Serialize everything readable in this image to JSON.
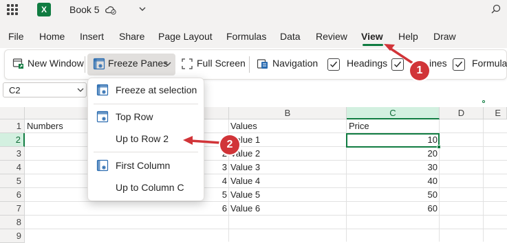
{
  "app": {
    "logo_letter": "X",
    "title": "Book 5"
  },
  "menu": {
    "tabs": [
      {
        "label": "File"
      },
      {
        "label": "Home"
      },
      {
        "label": "Insert"
      },
      {
        "label": "Share"
      },
      {
        "label": "Page Layout"
      },
      {
        "label": "Formulas"
      },
      {
        "label": "Data"
      },
      {
        "label": "Review"
      },
      {
        "label": "View"
      },
      {
        "label": "Help"
      },
      {
        "label": "Draw"
      }
    ],
    "active": "View"
  },
  "ribbon": {
    "new_window": "New Window",
    "freeze_panes": "Freeze Panes",
    "full_screen": "Full Screen",
    "navigation": "Navigation",
    "headings": "Headings",
    "gridlines_partial": "ines",
    "formula_partial": "Formula"
  },
  "name_box": {
    "value": "C2"
  },
  "grid": {
    "columns": [
      "B",
      "C",
      "D",
      "E"
    ],
    "selected_column": "C",
    "rows": [
      "1",
      "2",
      "3",
      "4",
      "5",
      "6",
      "7",
      "8",
      "9"
    ],
    "selected_row": "2",
    "a1": "Numbers",
    "b1": "Values",
    "c1": "Price",
    "a_values": [
      "2",
      "3",
      "4",
      "5",
      "6"
    ],
    "b_values": [
      "Value 1",
      "Value 2",
      "Value 3",
      "Value 4",
      "Value 5",
      "Value 6"
    ],
    "c_values": [
      "10",
      "20",
      "30",
      "40",
      "50",
      "60"
    ]
  },
  "dropdown": {
    "items": [
      "Freeze at selection",
      "Top Row",
      "Up to Row 2",
      "First Column",
      "Up to Column C"
    ]
  },
  "callouts": {
    "one": "1",
    "two": "2"
  },
  "colors": {
    "accent": "#107c41",
    "callout": "#d13438"
  }
}
